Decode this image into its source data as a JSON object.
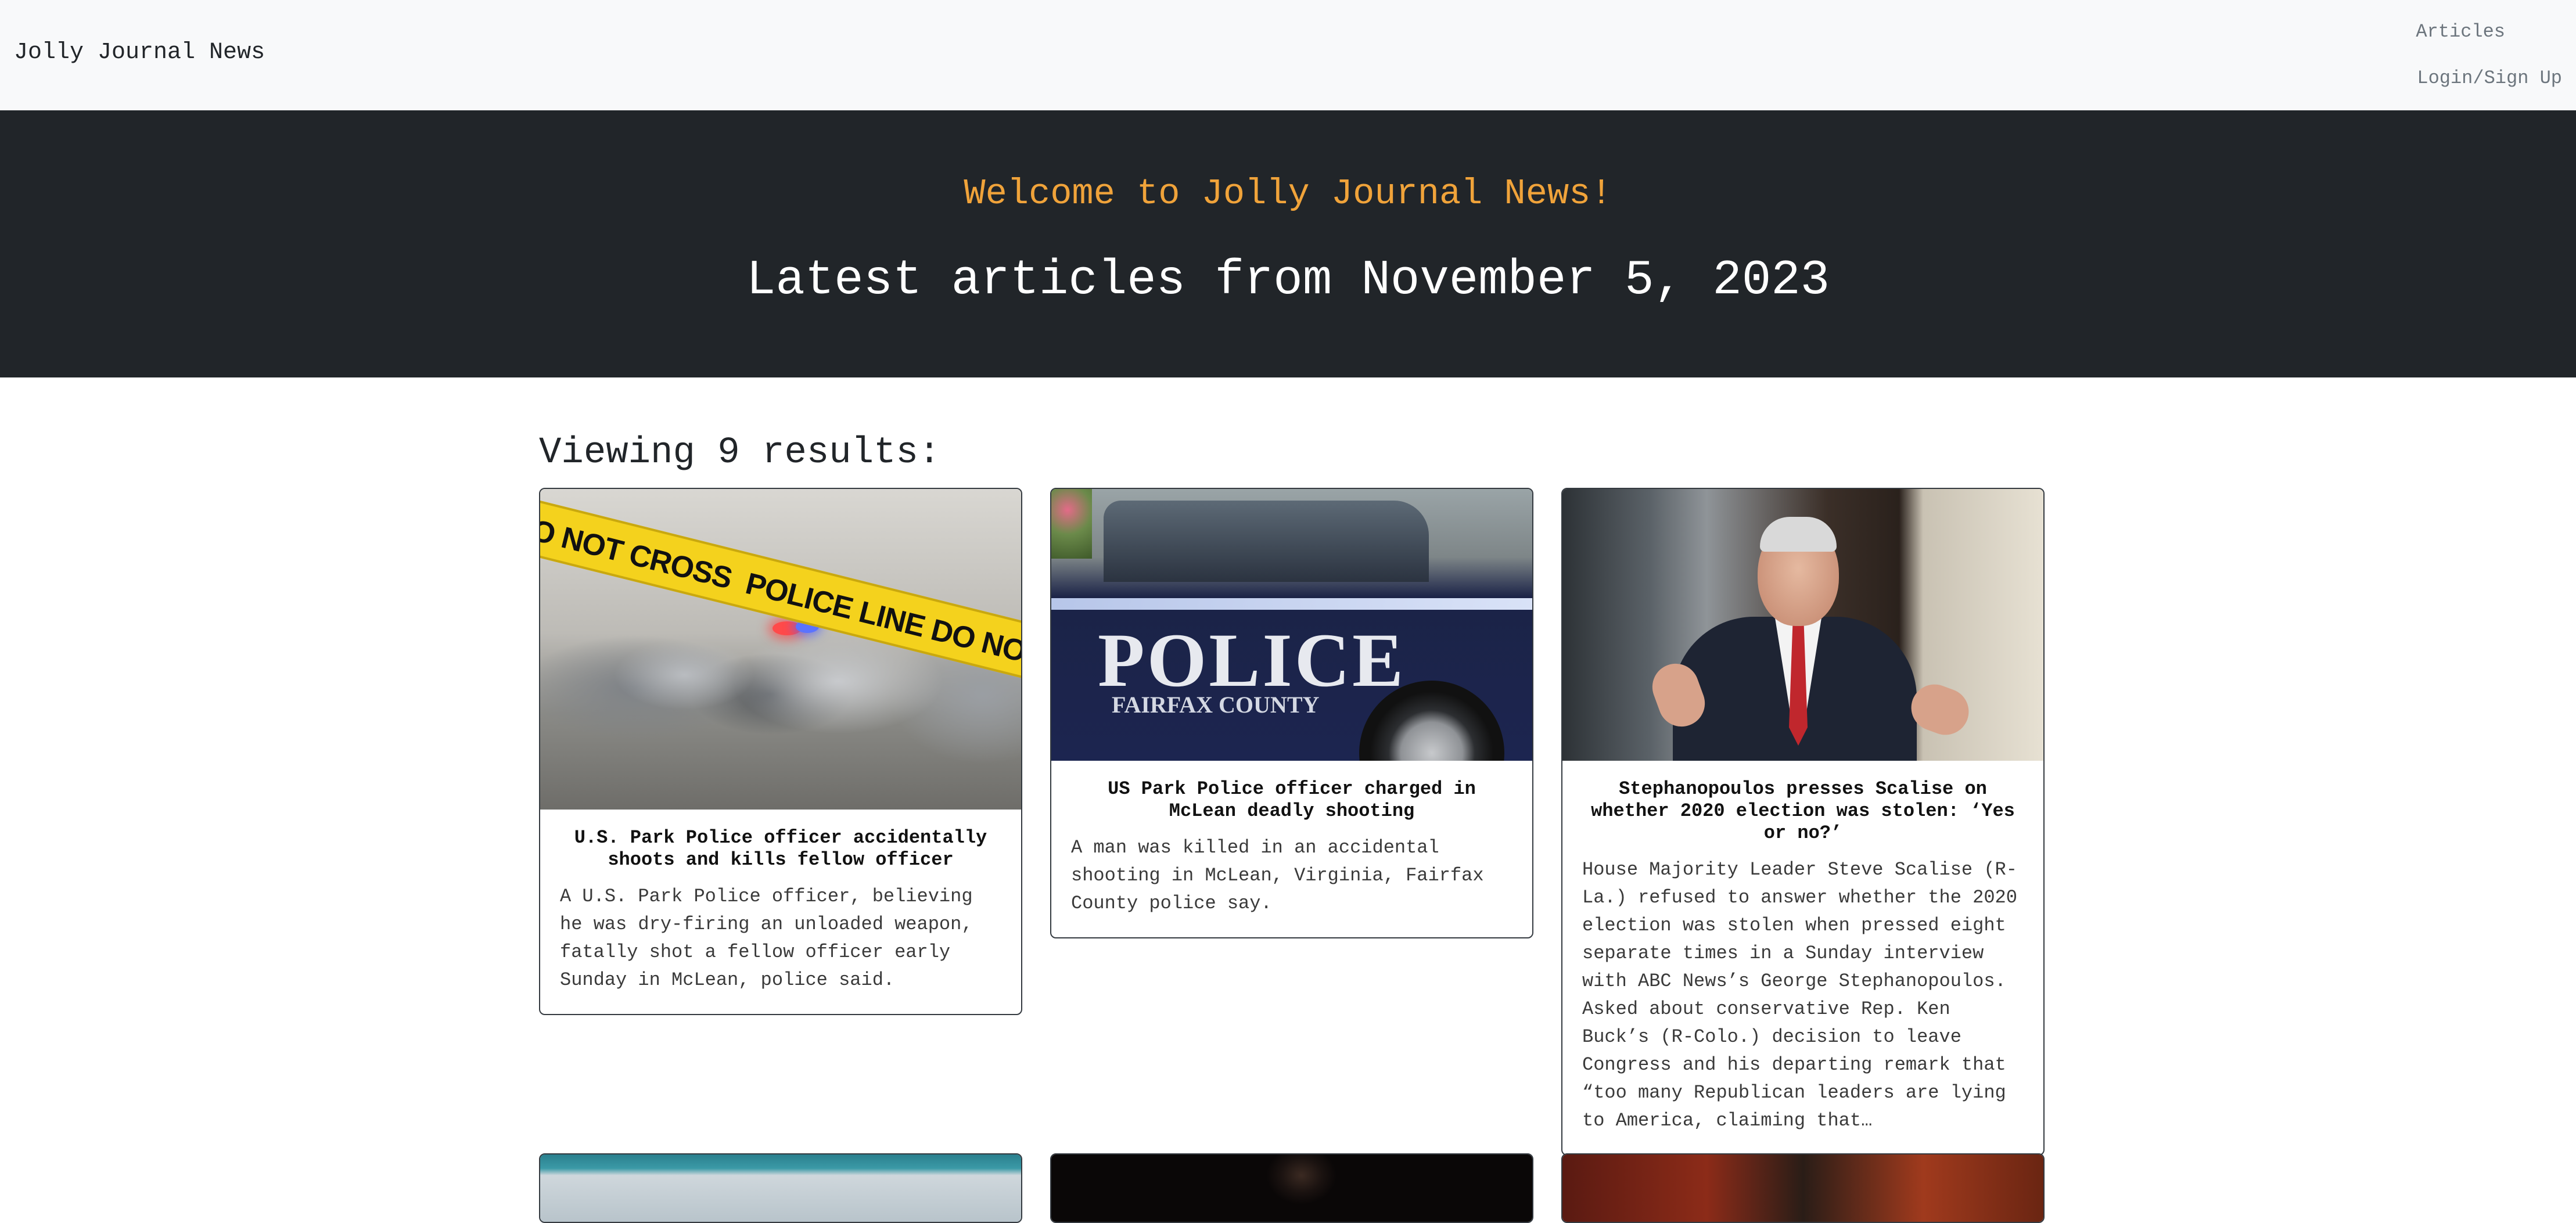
{
  "navbar": {
    "brand": "Jolly Journal News",
    "links": [
      {
        "label": "Articles"
      },
      {
        "label": "Login/Sign Up"
      }
    ]
  },
  "hero": {
    "welcome": "Welcome to Jolly Journal News!",
    "latest": "Latest articles from November 5, 2023"
  },
  "results": {
    "count_text": "Viewing 9 results:"
  },
  "images": {
    "tape_text_1": "O NOT CROSS",
    "tape_text_2": "POLICE LINE DO NOT CROSS",
    "car_word": "POLICE",
    "car_county": "FAIRFAX COUNTY"
  },
  "articles": [
    {
      "title": "U.S. Park Police officer accidentally shoots and kills fellow officer",
      "summary": "A U.S. Park Police officer, believing he was dry-firing an unloaded weapon, fatally shot a fellow officer early Sunday in McLean, police said."
    },
    {
      "title": "US Park Police officer charged in McLean deadly shooting",
      "summary": "A man was killed in an accidental shooting in McLean, Virginia, Fairfax County police say."
    },
    {
      "title": "Stephanopoulos presses Scalise on whether 2020 election was stolen: ‘Yes or no?’",
      "summary": "House Majority Leader Steve Scalise (R-La.) refused to answer whether the 2020 election was stolen when pressed eight separate times in a Sunday interview with ABC News’s George Stephanopoulos. Asked about conservative Rep. Ken Buck’s (R-Colo.) decision to leave Congress and his departing remark that “too many Republican leaders are lying to America, claiming that…"
    }
  ]
}
